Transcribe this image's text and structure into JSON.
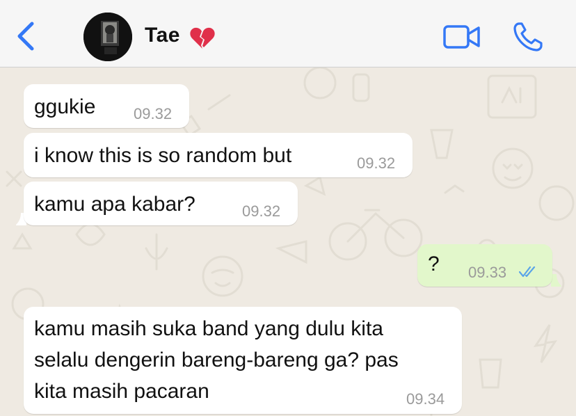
{
  "header": {
    "contact_name": "Tae",
    "back_icon": "chevron-left-icon",
    "status_emoji": "broken-heart-icon",
    "video_icon": "video-camera-icon",
    "call_icon": "phone-icon",
    "accent_color": "#3478f6"
  },
  "messages": [
    {
      "direction": "incoming",
      "text": "ggukie",
      "time": "09.32"
    },
    {
      "direction": "incoming",
      "text": "i know this is so random but",
      "time": "09.32"
    },
    {
      "direction": "incoming",
      "text": "kamu apa kabar?",
      "time": "09.32"
    },
    {
      "direction": "outgoing",
      "text": "?",
      "time": "09.33",
      "status": "read"
    },
    {
      "direction": "incoming",
      "lines": [
        "kamu masih suka band yang dulu kita",
        "selalu dengerin bareng-bareng ga? pas",
        "kita masih pacaran"
      ],
      "time": "09.34"
    }
  ],
  "colors": {
    "incoming_bubble": "#ffffff",
    "outgoing_bubble": "#e2f7cb",
    "read_ticks": "#5aa4e8",
    "wallpaper": "#efeae2"
  }
}
